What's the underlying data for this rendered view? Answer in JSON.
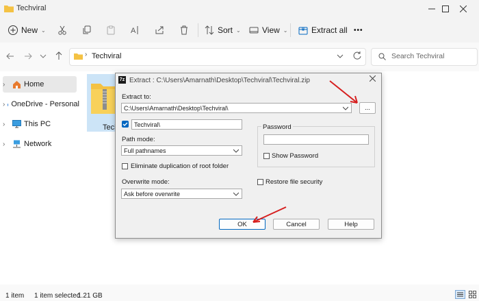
{
  "window": {
    "title": "Techviral"
  },
  "toolbar": {
    "new": "New",
    "sort": "Sort",
    "view": "View",
    "extract_all": "Extract all",
    "more": "•••"
  },
  "address": {
    "path": "Techviral",
    "search_placeholder": "Search Techviral"
  },
  "nav": {
    "items": [
      {
        "label": "Home"
      },
      {
        "label": "OneDrive - Personal"
      },
      {
        "label": "This PC"
      },
      {
        "label": "Network"
      }
    ]
  },
  "main": {
    "file_label": "Tech"
  },
  "status": {
    "items": "1 item",
    "selected": "1 item selected",
    "size": "1.21 GB"
  },
  "dialog": {
    "title": "Extract : C:\\Users\\Amarnath\\Desktop\\Techviral\\Techviral.zip",
    "extract_to_label": "Extract to:",
    "extract_to_value": "C:\\Users\\Amarnath\\Desktop\\Techviral\\",
    "browse_label": "...",
    "folder_value": "Techviral\\",
    "path_mode_label": "Path mode:",
    "path_mode_value": "Full pathnames",
    "eliminate_label": "Eliminate duplication of root folder",
    "overwrite_label": "Overwrite mode:",
    "overwrite_value": "Ask before overwrite",
    "password_label": "Password",
    "show_password_label": "Show Password",
    "restore_label": "Restore file security",
    "ok": "OK",
    "cancel": "Cancel",
    "help": "Help"
  },
  "colors": {
    "accent": "#0067c0",
    "arrow": "#d61f1f",
    "folder": "#f4c244"
  }
}
